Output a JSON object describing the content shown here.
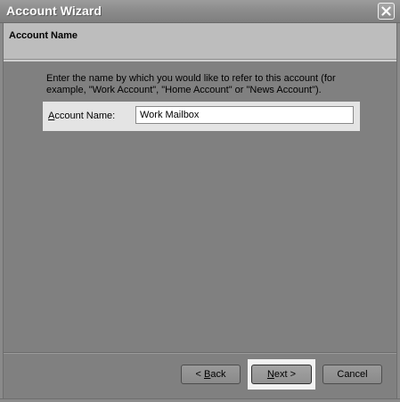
{
  "window": {
    "title": "Account Wizard",
    "close_icon": "close-icon"
  },
  "header": {
    "title": "Account Name"
  },
  "content": {
    "description": "Enter the name by which you would like to refer to this account (for example, \"Work Account\", \"Home Account\" or \"News Account\").",
    "account_name_label_prefix": "A",
    "account_name_label_rest": "ccount Name:",
    "account_name_value": "Work Mailbox"
  },
  "buttons": {
    "back_prefix": "< ",
    "back_accel": "B",
    "back_rest": "ack",
    "next_accel": "N",
    "next_rest": "ext >",
    "cancel": "Cancel"
  },
  "colors": {
    "window_bg": "#808080",
    "header_bg": "#bdbdbd",
    "input_bg": "#ffffff",
    "focus_halo": "#f2f2f2"
  }
}
